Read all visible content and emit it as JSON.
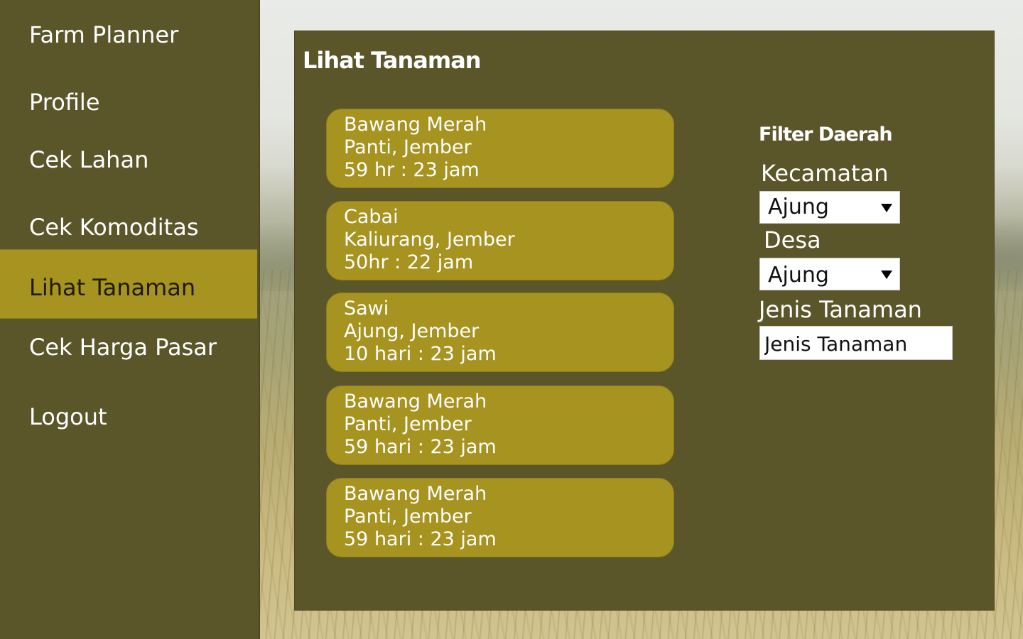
{
  "sidebar": {
    "app_title": "Farm Planner",
    "items": [
      {
        "label": "Profile"
      },
      {
        "label": "Cek Lahan"
      },
      {
        "label": "Cek Komoditas"
      },
      {
        "label": "Lihat Tanaman",
        "active": true
      },
      {
        "label": "Cek Harga Pasar"
      },
      {
        "label": "Logout"
      }
    ]
  },
  "main": {
    "title": "Lihat Tanaman",
    "crops": [
      {
        "name": "Bawang Merah",
        "location": "Panti, Jember",
        "time": "59 hr : 23 jam"
      },
      {
        "name": "Cabai",
        "location": "Kaliurang, Jember",
        "time": "50hr : 22 jam"
      },
      {
        "name": "Sawi",
        "location": "Ajung, Jember",
        "time": "10 hari : 23 jam"
      },
      {
        "name": "Bawang Merah",
        "location": "Panti, Jember",
        "time": "59 hari : 23 jam"
      },
      {
        "name": "Bawang Merah",
        "location": "Panti, Jember",
        "time": "59 hari : 23 jam"
      }
    ]
  },
  "filter": {
    "title": "Filter Daerah",
    "kecamatan_label": "Kecamatan",
    "kecamatan_value": "Ajung",
    "desa_label": "Desa",
    "desa_value": "Ajung",
    "jenis_label": "Jenis Tanaman",
    "jenis_placeholder": "Jenis Tanaman"
  },
  "colors": {
    "panel_bg": "#5b552a",
    "accent": "#a69320",
    "text": "#ffffff"
  }
}
